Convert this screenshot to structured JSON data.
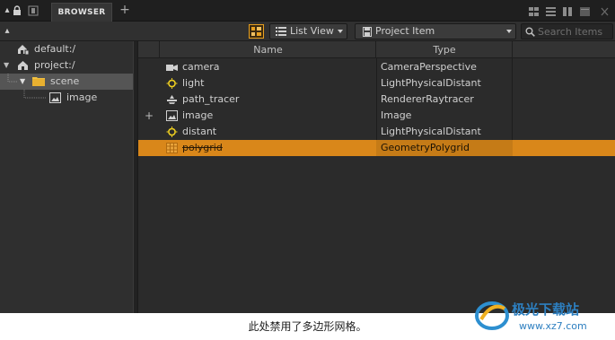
{
  "tabbar": {
    "tab_label": "BROWSER",
    "add_tab": "+"
  },
  "toolbar": {
    "view_mode": "List View",
    "filter": "Project Item",
    "search_placeholder": "Search Items"
  },
  "tree": {
    "items": [
      {
        "label": "default:/",
        "icon": "house-file-icon"
      },
      {
        "label": "project:/",
        "icon": "house-icon"
      },
      {
        "label": "scene",
        "icon": "folder-icon",
        "selected": true
      },
      {
        "label": "image",
        "icon": "image-icon"
      }
    ]
  },
  "table": {
    "columns": [
      "Name",
      "Type"
    ],
    "rows": [
      {
        "name": "camera",
        "type": "CameraPerspective",
        "icon": "camera-icon"
      },
      {
        "name": "light",
        "type": "LightPhysicalDistant",
        "icon": "light-icon"
      },
      {
        "name": "path_tracer",
        "type": "RendererRaytracer",
        "icon": "renderer-icon"
      },
      {
        "name": "image",
        "type": "Image",
        "icon": "image-icon",
        "expander": "+"
      },
      {
        "name": "distant",
        "type": "LightPhysicalDistant",
        "icon": "light-icon"
      },
      {
        "name": "polygrid",
        "type": "GeometryPolygrid",
        "icon": "grid-icon",
        "highlighted": true,
        "disabled": true
      }
    ]
  },
  "caption": "此处禁用了多边形网格。",
  "watermark": {
    "title": "极光下载站",
    "url": "www.xz7.com"
  },
  "colors": {
    "highlight": "#d9871a",
    "panel": "#2b2b2b",
    "accent_orange": "#e8a020"
  }
}
